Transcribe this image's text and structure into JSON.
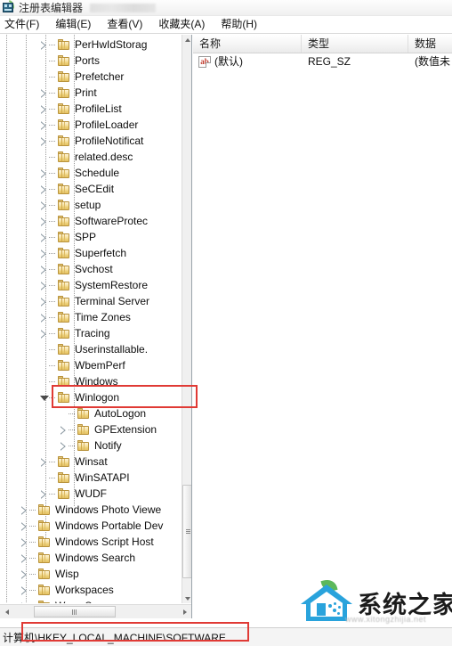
{
  "window": {
    "title": "注册表编辑器",
    "icon": "registry-editor-icon"
  },
  "menubar": {
    "items": [
      {
        "label": "文件(F)"
      },
      {
        "label": "编辑(E)"
      },
      {
        "label": "查看(V)"
      },
      {
        "label": "收藏夹(A)"
      },
      {
        "label": "帮助(H)"
      }
    ]
  },
  "tree": {
    "nodes": [
      {
        "label": "PerHwIdStorag",
        "indent": 3,
        "state": "collapsed"
      },
      {
        "label": "Ports",
        "indent": 3,
        "state": "leaf"
      },
      {
        "label": "Prefetcher",
        "indent": 3,
        "state": "leaf"
      },
      {
        "label": "Print",
        "indent": 3,
        "state": "collapsed"
      },
      {
        "label": "ProfileList",
        "indent": 3,
        "state": "collapsed"
      },
      {
        "label": "ProfileLoader",
        "indent": 3,
        "state": "collapsed"
      },
      {
        "label": "ProfileNotificat",
        "indent": 3,
        "state": "collapsed"
      },
      {
        "label": "related.desc",
        "indent": 3,
        "state": "leaf"
      },
      {
        "label": "Schedule",
        "indent": 3,
        "state": "collapsed"
      },
      {
        "label": "SeCEdit",
        "indent": 3,
        "state": "collapsed"
      },
      {
        "label": "setup",
        "indent": 3,
        "state": "collapsed"
      },
      {
        "label": "SoftwareProtec",
        "indent": 3,
        "state": "collapsed"
      },
      {
        "label": "SPP",
        "indent": 3,
        "state": "collapsed"
      },
      {
        "label": "Superfetch",
        "indent": 3,
        "state": "collapsed"
      },
      {
        "label": "Svchost",
        "indent": 3,
        "state": "collapsed"
      },
      {
        "label": "SystemRestore",
        "indent": 3,
        "state": "collapsed"
      },
      {
        "label": "Terminal Server",
        "indent": 3,
        "state": "collapsed"
      },
      {
        "label": "Time Zones",
        "indent": 3,
        "state": "collapsed"
      },
      {
        "label": "Tracing",
        "indent": 3,
        "state": "collapsed"
      },
      {
        "label": "Userinstallable.",
        "indent": 3,
        "state": "leaf"
      },
      {
        "label": "WbemPerf",
        "indent": 3,
        "state": "leaf"
      },
      {
        "label": "Windows",
        "indent": 3,
        "state": "leaf"
      },
      {
        "label": "Winlogon",
        "indent": 3,
        "state": "expanded",
        "highlighted": true
      },
      {
        "label": "AutoLogon",
        "indent": 4,
        "state": "leaf"
      },
      {
        "label": "GPExtension",
        "indent": 4,
        "state": "collapsed"
      },
      {
        "label": "Notify",
        "indent": 4,
        "state": "collapsed"
      },
      {
        "label": "Winsat",
        "indent": 3,
        "state": "collapsed"
      },
      {
        "label": "WinSATAPI",
        "indent": 3,
        "state": "leaf"
      },
      {
        "label": "WUDF",
        "indent": 3,
        "state": "collapsed"
      },
      {
        "label": "Windows Photo Viewe",
        "indent": 2,
        "state": "collapsed"
      },
      {
        "label": "Windows Portable Dev",
        "indent": 2,
        "state": "collapsed"
      },
      {
        "label": "Windows Script Host",
        "indent": 2,
        "state": "collapsed"
      },
      {
        "label": "Windows Search",
        "indent": 2,
        "state": "collapsed"
      },
      {
        "label": "Wisp",
        "indent": 2,
        "state": "collapsed"
      },
      {
        "label": "Workspaces",
        "indent": 2,
        "state": "collapsed"
      },
      {
        "label": "WwanSvc",
        "indent": 2,
        "state": "collapsed"
      }
    ]
  },
  "list": {
    "columns": [
      {
        "label": "名称"
      },
      {
        "label": "类型"
      },
      {
        "label": "数据"
      }
    ],
    "rows": [
      {
        "name": "(默认)",
        "type": "REG_SZ",
        "data": "(数值未",
        "icon": "string-value-icon"
      }
    ]
  },
  "statusbar": {
    "path": "计算机\\HKEY_LOCAL_MACHINE\\SOFTWARE"
  },
  "watermark": {
    "text": "系统之家",
    "url": "www.xitongzhijia.net"
  },
  "colors": {
    "annotation": "#e03a35",
    "folder": "#eccf76",
    "logo_blue": "#29a3dc",
    "logo_green": "#5cb85c"
  }
}
